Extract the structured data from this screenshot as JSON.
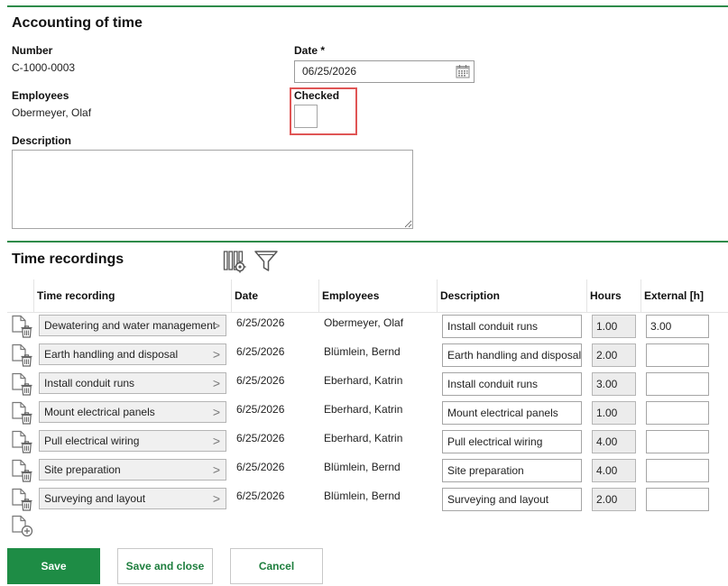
{
  "header": {
    "title": "Accounting of time"
  },
  "form": {
    "number_label": "Number",
    "number_value": "C-1000-0003",
    "date_label": "Date *",
    "date_value": "06/25/2026",
    "employees_label": "Employees",
    "employees_value": "Obermeyer, Olaf",
    "checked_label": "Checked",
    "checked_value": false,
    "description_label": "Description",
    "description_value": ""
  },
  "time_recordings": {
    "title": "Time recordings",
    "tool_icons": [
      "column-settings-icon",
      "filter-icon"
    ],
    "columns": [
      "Time recording",
      "Date",
      "Employees",
      "Description",
      "Hours",
      "External [h]"
    ],
    "rows": [
      {
        "time_recording": "Dewatering and water management",
        "date": "6/25/2026",
        "employee": "Obermeyer, Olaf",
        "description": "Install conduit runs",
        "hours": "1.00",
        "external": "3.00"
      },
      {
        "time_recording": "Earth handling and disposal",
        "date": "6/25/2026",
        "employee": "Blümlein, Bernd",
        "description": "Earth handling and disposal",
        "hours": "2.00",
        "external": ""
      },
      {
        "time_recording": "Install conduit runs",
        "date": "6/25/2026",
        "employee": "Eberhard, Katrin",
        "description": "Install conduit runs",
        "hours": "3.00",
        "external": ""
      },
      {
        "time_recording": "Mount electrical panels",
        "date": "6/25/2026",
        "employee": "Eberhard, Katrin",
        "description": "Mount electrical panels",
        "hours": "1.00",
        "external": ""
      },
      {
        "time_recording": "Pull electrical wiring",
        "date": "6/25/2026",
        "employee": "Eberhard, Katrin",
        "description": "Pull electrical wiring",
        "hours": "4.00",
        "external": ""
      },
      {
        "time_recording": "Site preparation",
        "date": "6/25/2026",
        "employee": "Blümlein, Bernd",
        "description": "Site preparation",
        "hours": "4.00",
        "external": ""
      },
      {
        "time_recording": "Surveying and layout",
        "date": "6/25/2026",
        "employee": "Blümlein, Bernd",
        "description": "Surveying and layout",
        "hours": "2.00",
        "external": ""
      }
    ]
  },
  "buttons": {
    "save": "Save",
    "save_and_close": "Save and close",
    "cancel": "Cancel"
  },
  "colors": {
    "accent": "#1e8c45",
    "highlight": "#e05555"
  }
}
